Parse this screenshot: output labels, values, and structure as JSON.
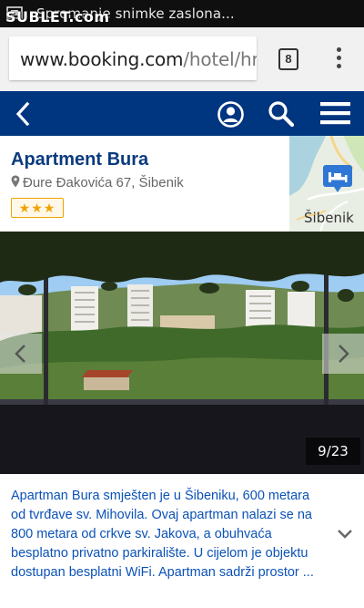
{
  "status_bar": {
    "notification_text": "Spremanje snimke zaslona...",
    "watermark": "SUBLET.com",
    "screenshot_icon": "screenshot-icon"
  },
  "browser": {
    "url_domain": "www.booking.com",
    "url_path": "/hotel/hr/",
    "tab_count": "8",
    "menu_icon": "vertical-dots-icon"
  },
  "nav": {
    "back_icon": "chevron-left-icon",
    "account_icon": "user-circle-icon",
    "search_icon": "search-icon",
    "menu_icon": "hamburger-menu-icon",
    "background": "#003580"
  },
  "hotel": {
    "name": "Apartment Bura",
    "address": "Đure Đakovića 67, Šibenik",
    "stars": "★★★",
    "map_label": "Šibenik"
  },
  "gallery": {
    "counter": "9/23",
    "prev_icon": "chevron-left-icon",
    "next_icon": "chevron-right-icon"
  },
  "description": {
    "text": "Apartman Bura smješten je u Šibeniku, 600 metara od tvrđave sv. Mihovila. Ovaj apartman nalazi se na 800 metara od crkve sv. Jakova, a obuhvaća besplatno privatno parkiralište. U cijelom je objektu dostupan besplatni WiFi. Apartman sadrži prostor ...",
    "expand_icon": "chevron-down-icon"
  },
  "colors": {
    "brand_blue": "#003580",
    "link_blue": "#0b52b8",
    "star_gold": "#f0a300"
  }
}
